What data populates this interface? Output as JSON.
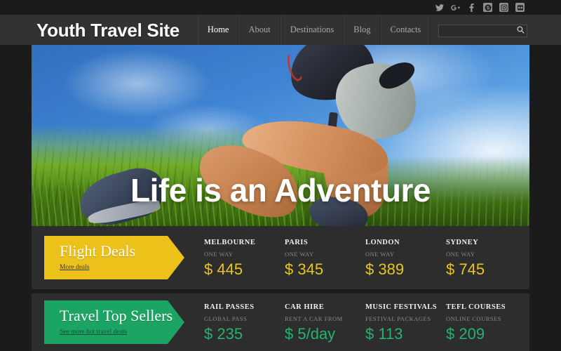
{
  "site": {
    "logo": "Youth Travel Site"
  },
  "social": {
    "items": [
      {
        "name": "twitter-icon",
        "label": "Twitter"
      },
      {
        "name": "google-plus-icon",
        "label": "Google Plus"
      },
      {
        "name": "facebook-icon",
        "label": "Facebook"
      },
      {
        "name": "skype-icon",
        "label": "Skype"
      },
      {
        "name": "instagram-icon",
        "label": "Instagram"
      },
      {
        "name": "flickr-icon",
        "label": "Flickr"
      }
    ]
  },
  "nav": {
    "items": [
      {
        "label": "Home",
        "active": true
      },
      {
        "label": "About",
        "active": false
      },
      {
        "label": "Destinations",
        "active": false
      },
      {
        "label": "Blog",
        "active": false
      },
      {
        "label": "Contacts",
        "active": false
      }
    ]
  },
  "search": {
    "value": "",
    "placeholder": "",
    "icon": "search-icon"
  },
  "hero": {
    "headline": "Life is an Adventure",
    "image_alt": "Hiker with backpack walking through tall grass under a blue sky"
  },
  "flight_deals": {
    "title": "Flight Deals",
    "link": "More deals",
    "accent": "#ecc11a",
    "items": [
      {
        "city": "MELBOURNE",
        "sub": "ONE WAY",
        "price": "$ 445"
      },
      {
        "city": "PARIS",
        "sub": "ONE WAY",
        "price": "$ 345"
      },
      {
        "city": "LONDON",
        "sub": "ONE WAY",
        "price": "$ 389"
      },
      {
        "city": "SYDNEY",
        "sub": "ONE WAY",
        "price": "$ 745"
      }
    ]
  },
  "top_sellers": {
    "title": "Travel Top Sellers",
    "link": "See more hot travel deals",
    "accent": "#1ba463",
    "items": [
      {
        "city": "RAIL PASSES",
        "sub": "GLOBAL PASS",
        "price": "$ 235"
      },
      {
        "city": "CAR HIRE",
        "sub": "RENT A CAR FROM",
        "price": "$ 5/day"
      },
      {
        "city": "MUSIC FESTIVALS",
        "sub": "FESTIVAL PACKAGES",
        "price": "$ 113"
      },
      {
        "city": "TEFL COURSES",
        "sub": "ONLINE COURSES",
        "price": "$ 209"
      }
    ]
  }
}
